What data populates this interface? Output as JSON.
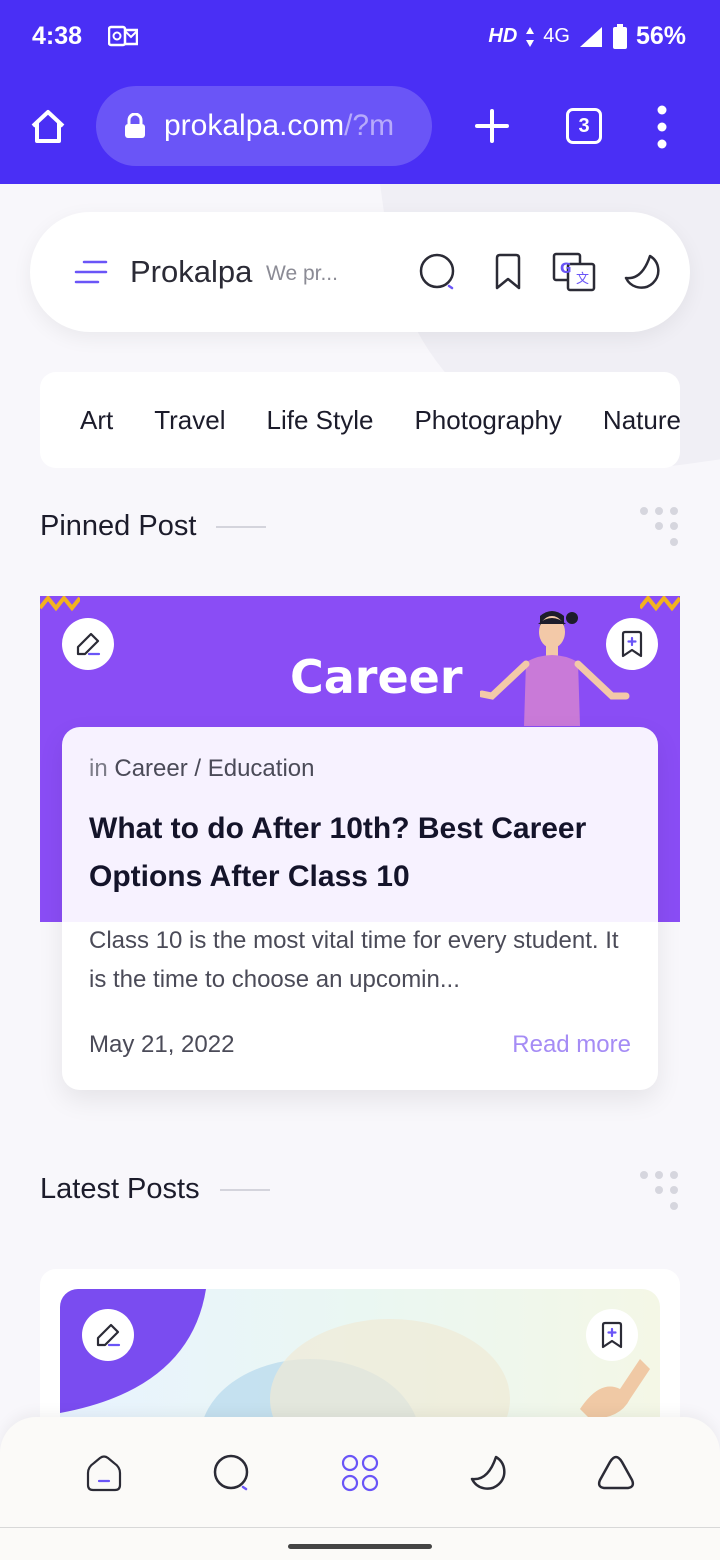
{
  "status_bar": {
    "time": "4:38",
    "network_hd": "HD",
    "network_type": "4G",
    "battery": "56%"
  },
  "browser": {
    "url_domain": "prokalpa.com",
    "url_rest": "/?m",
    "tab_count": "3"
  },
  "header": {
    "site_name": "Prokalpa",
    "tagline": "We pr..."
  },
  "categories": [
    "Art",
    "Travel",
    "Life Style",
    "Photography",
    "Nature"
  ],
  "pinned_section": {
    "title": "Pinned Post",
    "image_text": "Career",
    "post": {
      "category_prefix": "in",
      "category": "Career / Education",
      "title": "What to do After 10th? Best Career Options After Class 10",
      "excerpt": "Class 10 is the most vital time for every student. It is the time to choose an upcomin...",
      "date": "May 21, 2022",
      "read_more": "Read more"
    }
  },
  "latest_section": {
    "title": "Latest Posts"
  },
  "colors": {
    "accent": "#4a2ff5",
    "pinned_image_bg": "#8a4df5",
    "read_more": "#a58cf5"
  },
  "icons": {
    "header": [
      "hamburger-menu-icon",
      "search-icon",
      "bookmark-icon",
      "translate-icon",
      "dark-mode-moon-icon"
    ],
    "bottom_nav": [
      "home-icon",
      "search-icon",
      "categories-grid-icon",
      "dark-mode-moon-icon",
      "top-arrow-icon"
    ]
  }
}
